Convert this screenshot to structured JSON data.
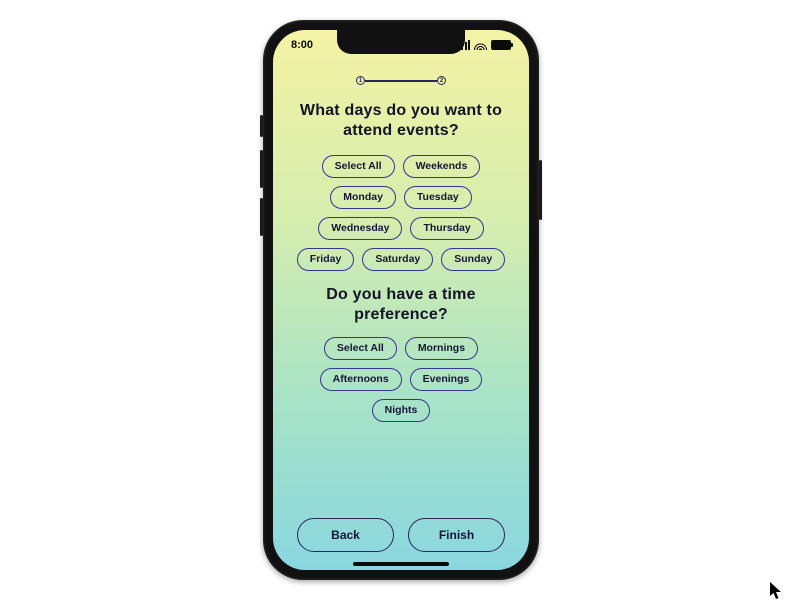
{
  "status": {
    "time": "8:00"
  },
  "progress": {
    "step1": "1",
    "step2": "2"
  },
  "q1": {
    "title": "What days do you want to attend events?",
    "chips": [
      "Select All",
      "Weekends",
      "Monday",
      "Tuesday",
      "Wednesday",
      "Thursday",
      "Friday",
      "Saturday",
      "Sunday"
    ]
  },
  "q2": {
    "title": "Do you have a time preference?",
    "chips": [
      "Select All",
      "Mornings",
      "Afternoons",
      "Evenings",
      "Nights"
    ]
  },
  "nav": {
    "back": "Back",
    "finish": "Finish"
  }
}
